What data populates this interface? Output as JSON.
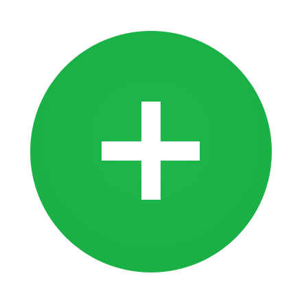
{
  "button": {
    "icon": "plus-icon",
    "background_color": "#1bb347",
    "icon_color": "#ffffff"
  }
}
